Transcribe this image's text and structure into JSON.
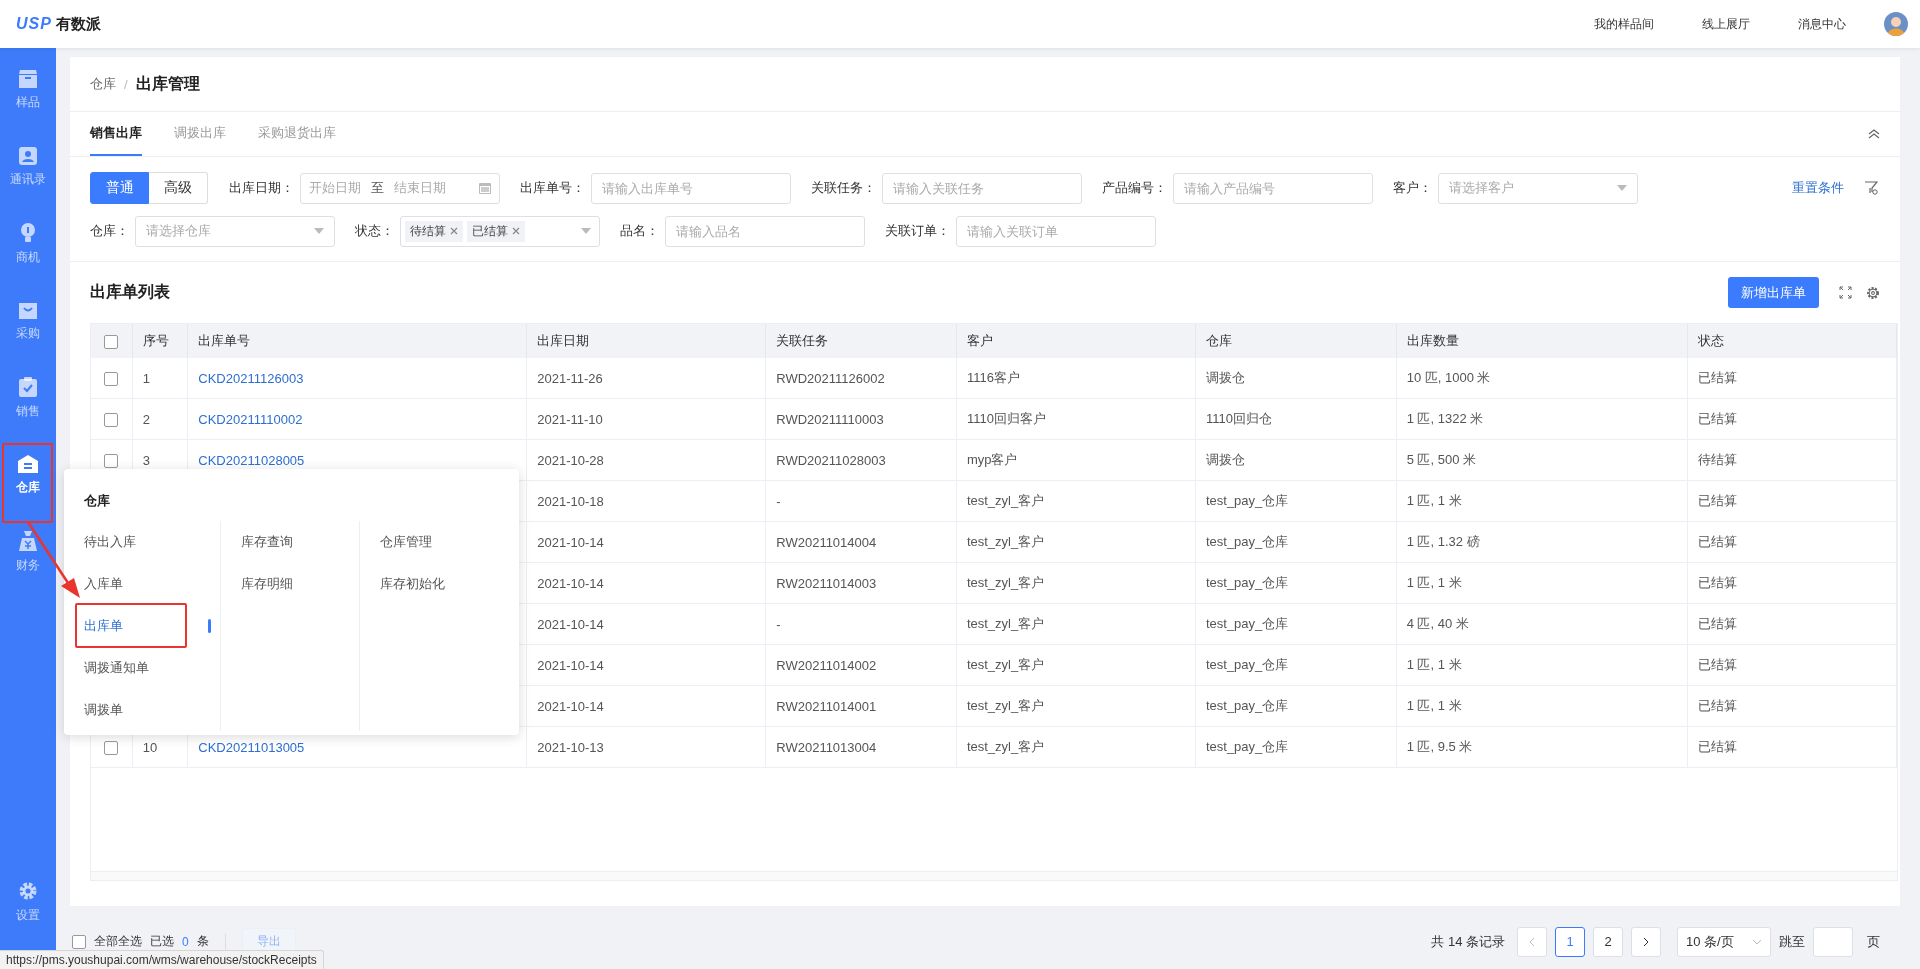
{
  "topbar": {
    "logo_mark": "USP",
    "logo_text": "有数派",
    "links": [
      "我的样品间",
      "线上展厅",
      "消息中心"
    ]
  },
  "sidebar": {
    "items": [
      {
        "label": "样品",
        "selected": false
      },
      {
        "label": "通讯录",
        "selected": false
      },
      {
        "label": "商机",
        "selected": false
      },
      {
        "label": "采购",
        "selected": false
      },
      {
        "label": "销售",
        "selected": false
      },
      {
        "label": "仓库",
        "selected": true
      },
      {
        "label": "财务",
        "selected": false
      },
      {
        "label": "设置",
        "selected": false
      }
    ]
  },
  "breadcrumb": {
    "parent": "仓库",
    "separator": "/",
    "current": "出库管理"
  },
  "tabs": [
    {
      "label": "销售出库",
      "selected": true
    },
    {
      "label": "调拨出库",
      "selected": false
    },
    {
      "label": "采购退货出库",
      "selected": false
    }
  ],
  "filter_mode": [
    {
      "label": "普通",
      "selected": true
    },
    {
      "label": "高级",
      "selected": false
    }
  ],
  "filters": [
    {
      "kind": "daterange",
      "label": "出库日期：",
      "start_placeholder": "开始日期",
      "separator": "至",
      "end_placeholder": "结束日期"
    },
    {
      "kind": "text",
      "label": "出库单号：",
      "placeholder": "请输入出库单号"
    },
    {
      "kind": "text",
      "label": "关联任务：",
      "placeholder": "请输入关联任务"
    },
    {
      "kind": "text",
      "label": "产品编号：",
      "placeholder": "请输入产品编号"
    },
    {
      "kind": "select",
      "label": "客户：",
      "placeholder": "请选择客户"
    },
    {
      "kind": "select",
      "label": "仓库：",
      "placeholder": "请选择仓库"
    },
    {
      "kind": "tags",
      "label": "状态：",
      "tags": [
        "待结算",
        "已结算"
      ]
    },
    {
      "kind": "text",
      "label": "品名：",
      "placeholder": "请输入品名"
    },
    {
      "kind": "text",
      "label": "关联订单：",
      "placeholder": "请输入关联订单"
    }
  ],
  "reset_link": "重置条件",
  "list_title": "出库单列表",
  "add_button": "新增出库单",
  "table": {
    "header_checked": false,
    "columns": [
      "序号",
      "出库单号",
      "出库日期",
      "关联任务",
      "客户",
      "仓库",
      "出库数量",
      "状态"
    ],
    "rows": [
      {
        "checked": false,
        "seq": "1",
        "order_no": "CKD20211126003",
        "date": "2021-11-26",
        "task": "RWD20211126002",
        "customer": "1116客户",
        "warehouse": "调拨仓",
        "quantity": "10 匹, 1000 米",
        "status": "已结算"
      },
      {
        "checked": false,
        "seq": "2",
        "order_no": "CKD20211110002",
        "date": "2021-11-10",
        "task": "RWD20211110003",
        "customer": "1110回归客户",
        "warehouse": "1110回归仓",
        "quantity": "1 匹, 1322 米",
        "status": "已结算"
      },
      {
        "checked": false,
        "seq": "3",
        "order_no": "CKD20211028005",
        "date": "2021-10-28",
        "task": "RWD20211028003",
        "customer": "myp客户",
        "warehouse": "调拨仓",
        "quantity": "5 匹, 500 米",
        "status": "待结算"
      },
      {
        "date": "2021-10-18",
        "task": "-",
        "customer": "test_zyl_客户",
        "warehouse": "test_pay_仓库",
        "quantity": "1 匹, 1 米",
        "status": "已结算"
      },
      {
        "date": "2021-10-14",
        "task": "RW20211014004",
        "customer": "test_zyl_客户",
        "warehouse": "test_pay_仓库",
        "quantity": "1 匹, 1.32 磅",
        "status": "已结算"
      },
      {
        "date": "2021-10-14",
        "task": "RW20211014003",
        "customer": "test_zyl_客户",
        "warehouse": "test_pay_仓库",
        "quantity": "1 匹, 1 米",
        "status": "已结算"
      },
      {
        "date": "2021-10-14",
        "task": "-",
        "customer": "test_zyl_客户",
        "warehouse": "test_pay_仓库",
        "quantity": "4 匹, 40 米",
        "status": "已结算"
      },
      {
        "date": "2021-10-14",
        "task": "RW20211014002",
        "customer": "test_zyl_客户",
        "warehouse": "test_pay_仓库",
        "quantity": "1 匹, 1 米",
        "status": "已结算"
      },
      {
        "date": "2021-10-14",
        "task": "RW20211014001",
        "customer": "test_zyl_客户",
        "warehouse": "test_pay_仓库",
        "quantity": "1 匹, 1 米",
        "status": "已结算"
      },
      {
        "checked": false,
        "seq": "10",
        "order_no": "CKD20211013005",
        "date": "2021-10-13",
        "task": "RW20211013004",
        "customer": "test_zyl_客户",
        "warehouse": "test_pay_仓库",
        "quantity": "1 匹, 9.5 米",
        "status": "已结算"
      }
    ]
  },
  "menu": {
    "title": "仓库",
    "columns": [
      {
        "items": [
          {
            "label": "待出入库",
            "selected": false
          },
          {
            "label": "入库单",
            "selected": false
          },
          {
            "label": "出库单",
            "selected": true
          },
          {
            "label": "调拨通知单",
            "selected": false
          },
          {
            "label": "调拨单",
            "selected": false
          }
        ]
      },
      {
        "items": [
          {
            "label": "库存查询",
            "selected": false
          },
          {
            "label": "库存明细",
            "selected": false
          }
        ]
      },
      {
        "items": [
          {
            "label": "仓库管理",
            "selected": false
          },
          {
            "label": "库存初始化",
            "selected": false
          }
        ]
      }
    ]
  },
  "footer": {
    "select_all_checked": false,
    "select_all": "全部全选",
    "selected_label": "已选",
    "selected_count": "0",
    "selected_unit": "条",
    "export_button": "导出",
    "export_disabled": true,
    "total": "共 14 条记录",
    "pages": [
      {
        "label": "1",
        "selected": true
      },
      {
        "label": "2",
        "selected": false
      }
    ],
    "page_size": "10 条/页",
    "jump_label": "跳至",
    "jump_unit": "页"
  },
  "status_url": "https://pms.youshupai.com/wms/warehouse/stockReceipts"
}
